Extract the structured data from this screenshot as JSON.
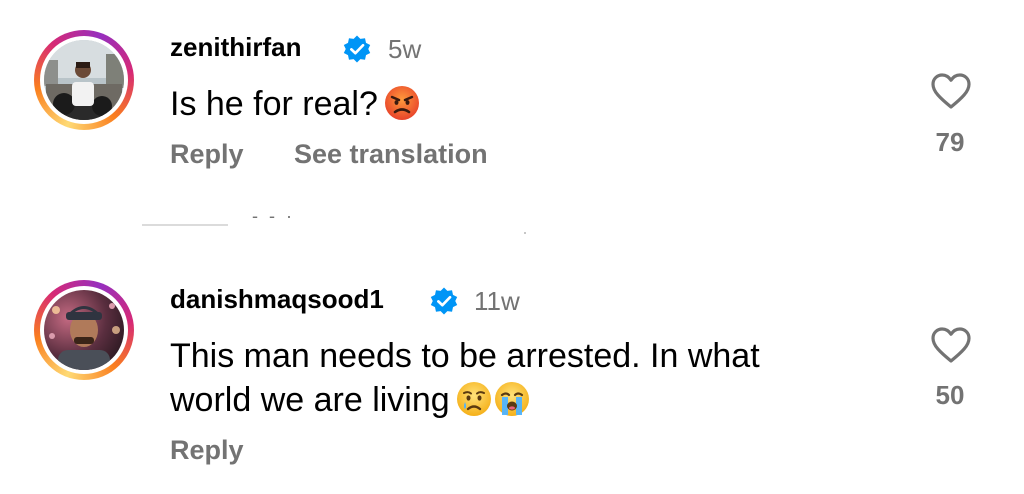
{
  "comments": [
    {
      "username": "zenithirfan",
      "verified": true,
      "timestamp": "5w",
      "text": "Is he for real?",
      "emojis": [
        "angry-face"
      ],
      "actions": {
        "reply_label": "Reply",
        "translate_label": "See translation"
      },
      "likes": "79"
    },
    {
      "username": "danishmaqsood1",
      "verified": true,
      "timestamp": "11w",
      "text_line1": "This man needs to be arrested. In what",
      "text_line2": "world we are living",
      "emojis": [
        "crying-face",
        "loudly-crying-face"
      ],
      "actions": {
        "reply_label": "Reply"
      },
      "likes": "50"
    }
  ],
  "colors": {
    "text_primary": "#000000",
    "text_secondary": "#737373",
    "verified_blue": "#0095f6",
    "divider": "#dbdbdb"
  },
  "icons": {
    "verified": "verified-badge-icon",
    "like": "heart-outline-icon"
  }
}
